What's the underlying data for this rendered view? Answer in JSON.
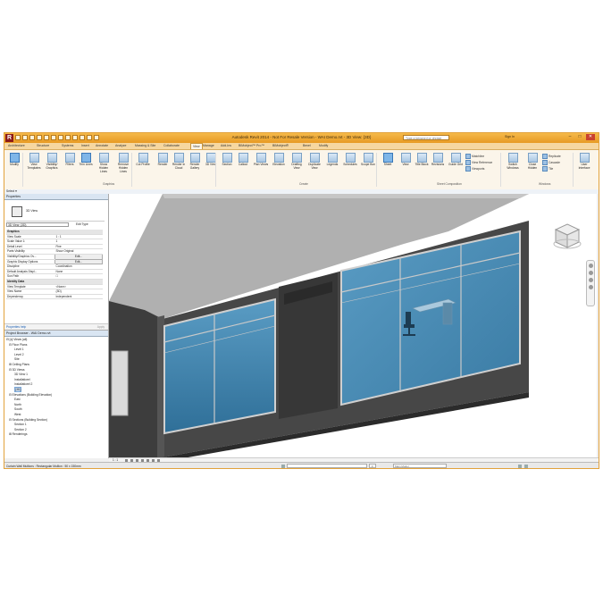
{
  "app": {
    "title": "Autodesk Revit 2014 - Not For Resale Version -    WAI Demo.rvt - 3D View: {3D}",
    "logo": "R",
    "search_placeholder": "Type a keyword or phrase",
    "signin": "Sign In",
    "accent": "#e79a24"
  },
  "tabs": [
    "Architecture",
    "Structure",
    "Systems",
    "Insert",
    "Annotate",
    "Analyze",
    "Massing & Site",
    "Collaborate",
    "View",
    "Manage",
    "Add-Ins",
    "BIMobject™ Pro™",
    "BIMobject®",
    "Bexel",
    "Modify"
  ],
  "active_tab": "View",
  "ribbon": {
    "buttons": [
      {
        "label": "Modify",
        "icon": "arrow-icon",
        "sel": true
      },
      {
        "label": "View Templates",
        "icon": "view-template-icon"
      },
      {
        "label": "Visibility/ Graphics",
        "icon": "visibility-icon"
      },
      {
        "label": "Filters",
        "icon": "filter-icon"
      },
      {
        "label": "Thin Lines",
        "icon": "thin-lines-icon",
        "sel": true
      },
      {
        "label": "Show Hidden Lines",
        "icon": "show-hidden-icon"
      },
      {
        "label": "Remove Hidden Lines",
        "icon": "remove-hidden-icon"
      },
      {
        "label": "Cut Profile",
        "icon": "cut-profile-icon"
      },
      {
        "label": "Render",
        "icon": "teapot-icon"
      },
      {
        "label": "Render in Cloud",
        "icon": "cloud-render-icon"
      },
      {
        "label": "Render Gallery",
        "icon": "gallery-icon"
      },
      {
        "label": "3D View",
        "icon": "house-3d-icon"
      },
      {
        "label": "Section",
        "icon": "section-icon"
      },
      {
        "label": "Callout",
        "icon": "callout-icon"
      },
      {
        "label": "Plan Views",
        "icon": "plan-icon"
      },
      {
        "label": "Elevation",
        "icon": "elevation-icon"
      },
      {
        "label": "Drafting View",
        "icon": "drafting-icon"
      },
      {
        "label": "Duplicate View",
        "icon": "duplicate-icon"
      },
      {
        "label": "Legends",
        "icon": "legend-icon"
      },
      {
        "label": "Schedules",
        "icon": "schedule-icon"
      },
      {
        "label": "Scope Box",
        "icon": "scope-box-icon"
      },
      {
        "label": "Sheet",
        "icon": "sheet-icon",
        "sel": true
      },
      {
        "label": "View",
        "icon": "view-icon"
      },
      {
        "label": "Title Block",
        "icon": "title-block-icon"
      },
      {
        "label": "Revisions",
        "icon": "revisions-icon"
      },
      {
        "label": "Guide Grid",
        "icon": "grid-icon"
      },
      {
        "label": "Switch Windows",
        "icon": "switch-windows-icon"
      },
      {
        "label": "Close Hidden",
        "icon": "close-hidden-icon"
      },
      {
        "label": "User Interface",
        "icon": "user-interface-icon"
      }
    ],
    "small": {
      "matchline": "Matchline",
      "view_reference": "View Reference",
      "viewports": "Viewports",
      "replicate": "Replicate",
      "cascade": "Cascade",
      "tile": "Tile"
    },
    "groups": {
      "graphics": "Graphics",
      "create": "Create",
      "sheet": "Sheet Composition",
      "windows": "Windows"
    }
  },
  "select_bar": "Select ▾",
  "properties": {
    "header": "Properties",
    "type_name": "3D View",
    "instance_selector": "3D View: {3D}",
    "edit_type": "Edit Type",
    "rows": [
      {
        "cat": true,
        "k": "Graphics",
        "v": ""
      },
      {
        "k": "View Scale",
        "v": "1 : 1"
      },
      {
        "k": "Scale Value   1:",
        "v": "1"
      },
      {
        "k": "Detail Level",
        "v": "Fine"
      },
      {
        "k": "Parts Visibility",
        "v": "Show Original"
      },
      {
        "k": "Visibility/Graphics Ov...",
        "v": "Edit...",
        "btn": true
      },
      {
        "k": "Graphic Display Options",
        "v": "Edit...",
        "btn": true
      },
      {
        "k": "Discipline",
        "v": "Coordination"
      },
      {
        "k": "Default Analysis Displ...",
        "v": "None"
      },
      {
        "k": "Sun Path",
        "v": "☐"
      },
      {
        "cat": true,
        "k": "Identity Data",
        "v": ""
      },
      {
        "k": "View Template",
        "v": "<None>"
      },
      {
        "k": "View Name",
        "v": "{3D}"
      },
      {
        "k": "Dependency",
        "v": "Independent"
      }
    ],
    "help": "Properties help",
    "apply": "Apply"
  },
  "browser": {
    "header": "Project Browser - WAI Demo.rvt",
    "nodes": [
      {
        "t": "⊟ [o] Views (all)",
        "l": 0
      },
      {
        "t": "⊟ Floor Plans",
        "l": 1
      },
      {
        "t": "Level 1",
        "l": 3
      },
      {
        "t": "Level 2",
        "l": 3
      },
      {
        "t": "Site",
        "l": 3
      },
      {
        "t": "⊞ Ceiling Plans",
        "l": 1
      },
      {
        "t": "⊟ 3D Views",
        "l": 1
      },
      {
        "t": "3D View 1",
        "l": 3
      },
      {
        "t": "Installatiorel",
        "l": 3
      },
      {
        "t": "Installatiorel 2",
        "l": 3
      },
      {
        "t": "{3D}",
        "l": 3,
        "hl": true
      },
      {
        "t": "⊟ Elevations (Building Elevation)",
        "l": 1
      },
      {
        "t": "East",
        "l": 3
      },
      {
        "t": "North",
        "l": 3
      },
      {
        "t": "South",
        "l": 3
      },
      {
        "t": "West",
        "l": 3
      },
      {
        "t": "⊟ Sections (Building Section)",
        "l": 1
      },
      {
        "t": "Section 1",
        "l": 3
      },
      {
        "t": "Section 2",
        "l": 3
      },
      {
        "t": "⊞ Renderings",
        "l": 1
      }
    ]
  },
  "view_controls": {
    "scale": "1 : 1",
    "main_model": "Main Model"
  },
  "status": {
    "text": "Curtain Wall Mullions : Rectangular Mullion : 50 x 150mm",
    "zero": ":0"
  },
  "colors": {
    "glass": "#3f7fa6",
    "wall": "#4a4a4a",
    "roof": "#a8a8a8"
  }
}
